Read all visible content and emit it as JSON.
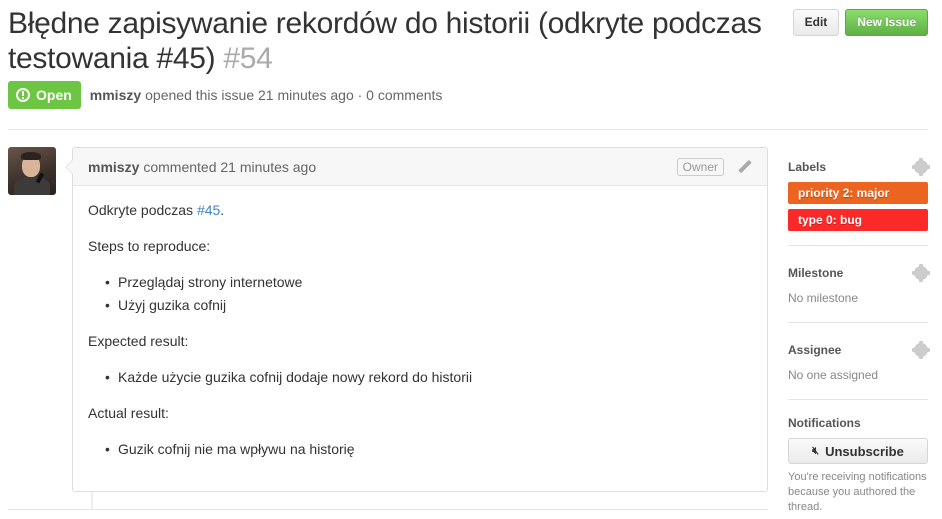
{
  "issue": {
    "title": "Błędne zapisywanie rekordów do historii (odkryte podczas testowania #45)",
    "number": "#54",
    "state": "Open",
    "author": "mmiszy",
    "opened_text": "opened this issue 21 minutes ago · 0 comments"
  },
  "actions": {
    "edit_label": "Edit",
    "new_issue_label": "New Issue"
  },
  "comment": {
    "author": "mmiszy",
    "meta": "commented 21 minutes ago",
    "owner_badge": "Owner",
    "intro": "Odkryte podczas ",
    "intro_link": "#45",
    "intro_end": ".",
    "steps_heading": "Steps to reproduce:",
    "steps": [
      "Przeglądaj strony internetowe",
      "Użyj guzika cofnij"
    ],
    "expected_heading": "Expected result:",
    "expected": [
      "Każde użycie guzika cofnij dodaje nowy rekord do historii"
    ],
    "actual_heading": "Actual result:",
    "actual": [
      "Guzik cofnij nie ma wpływu na historię"
    ]
  },
  "sidebar": {
    "labels_title": "Labels",
    "labels": [
      {
        "name": "priority 2: major",
        "color": "#eb6420"
      },
      {
        "name": "type 0: bug",
        "color": "#fc2929"
      }
    ],
    "milestone_title": "Milestone",
    "milestone_value": "No milestone",
    "assignee_title": "Assignee",
    "assignee_value": "No one assigned",
    "notifications_title": "Notifications",
    "unsubscribe_label": "Unsubscribe",
    "notifications_note": "You're receiving notifications because you authored the thread."
  },
  "colors": {
    "open_state": "#6cc644",
    "link": "#4183c4",
    "new_issue": "#60b044"
  }
}
